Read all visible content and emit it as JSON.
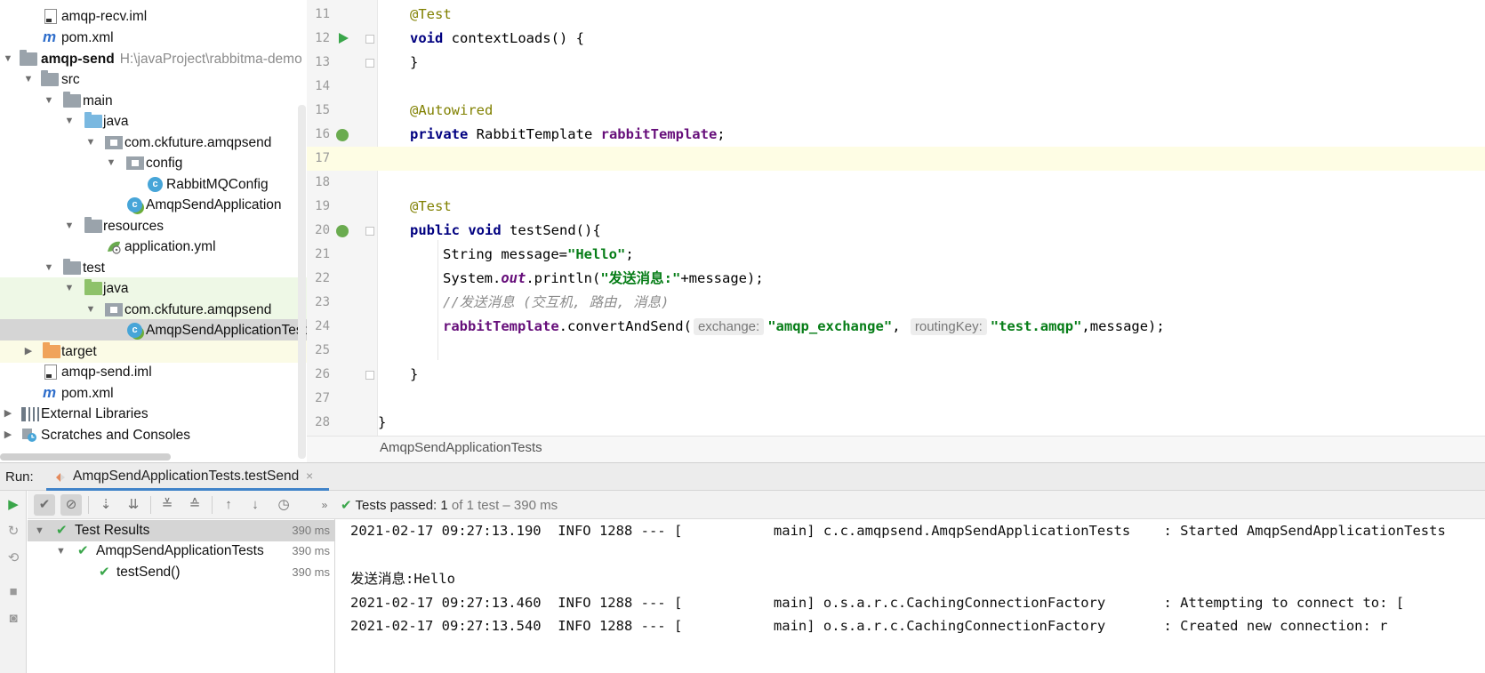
{
  "project_tree": {
    "items": [
      {
        "label": "amqp-recv.iml",
        "path": "",
        "icon": "iml-file-icon"
      },
      {
        "label": "pom.xml",
        "path": "",
        "icon": "maven-icon"
      },
      {
        "label": "amqp-send",
        "path": "H:\\javaProject\\rabbitma-demo",
        "icon": "module-folder-icon"
      },
      {
        "label": "src",
        "icon": "folder-icon"
      },
      {
        "label": "main",
        "icon": "folder-icon"
      },
      {
        "label": "java",
        "icon": "source-folder-icon"
      },
      {
        "label": "com.ckfuture.amqpsend",
        "icon": "package-icon"
      },
      {
        "label": "config",
        "icon": "package-icon"
      },
      {
        "label": "RabbitMQConfig",
        "icon": "class-icon"
      },
      {
        "label": "AmqpSendApplication",
        "icon": "spring-boot-class-icon"
      },
      {
        "label": "resources",
        "icon": "resources-folder-icon"
      },
      {
        "label": "application.yml",
        "icon": "yaml-icon"
      },
      {
        "label": "test",
        "icon": "folder-icon"
      },
      {
        "label": "java",
        "icon": "test-folder-icon"
      },
      {
        "label": "com.ckfuture.amqpsend",
        "icon": "package-icon"
      },
      {
        "label": "AmqpSendApplicationTests",
        "icon": "spring-boot-class-icon"
      },
      {
        "label": "target",
        "icon": "excluded-folder-icon"
      },
      {
        "label": "amqp-send.iml",
        "icon": "iml-file-icon"
      },
      {
        "label": "pom.xml",
        "icon": "maven-icon"
      },
      {
        "label": "External Libraries",
        "icon": "libraries-icon"
      },
      {
        "label": "Scratches and Consoles",
        "icon": "scratches-icon"
      }
    ],
    "class_glyph": "c"
  },
  "editor": {
    "line_numbers": [
      "11",
      "12",
      "13",
      "14",
      "15",
      "16",
      "17",
      "18",
      "19",
      "20",
      "21",
      "22",
      "23",
      "24",
      "25",
      "26",
      "27",
      "28"
    ],
    "tokens": {
      "l11_annotation": "@Test",
      "l12_kw": "void",
      "l12_rest": " contextLoads() {",
      "l13": "}",
      "l15_annotation": "@Autowired",
      "l16_kw": "private",
      "l16_type": " RabbitTemplate ",
      "l16_field": "rabbitTemplate",
      "l16_end": ";",
      "l19_annotation": "@Test",
      "l20_kw1": "public",
      "l20_sp": " ",
      "l20_kw2": "void",
      "l20_rest": " testSend(){",
      "l21_pre": "String message=",
      "l21_str": "\"Hello\"",
      "l21_end": ";",
      "l22_pre": "System.",
      "l22_static": "out",
      "l22_mid": ".println(",
      "l22_str": "\"发送消息:\"",
      "l22_end": "+message);",
      "l23_comment": "//发送消息 (交互机, 路由, 消息)",
      "l24_field": "rabbitTemplate",
      "l24_call": ".convertAndSend(",
      "l24_hint1": "exchange:",
      "l24_str1": "\"amqp_exchange\"",
      "l24_comma": ", ",
      "l24_hint2": "routingKey:",
      "l24_str2": "\"test.amqp\"",
      "l24_end": ",message);",
      "l26": "}",
      "l28": "}"
    },
    "breadcrumb": "AmqpSendApplicationTests"
  },
  "run_panel": {
    "label": "Run:",
    "tab_label": "AmqpSendApplicationTests.testSend",
    "close_glyph": "×",
    "status_prefix": "Tests passed:",
    "status_count": " 1",
    "status_suffix": " of 1 test – 390 ms",
    "results": [
      {
        "label": "Test Results",
        "time": "390 ms"
      },
      {
        "label": "AmqpSendApplicationTests",
        "time": "390 ms"
      },
      {
        "label": "testSend()",
        "time": "390 ms"
      }
    ],
    "console_lines": [
      "2021-02-17 09:27:13.190  INFO 1288 --- [           main] c.c.amqpsend.AmqpSendApplicationTests    : Started AmqpSendApplicationTests",
      "",
      "发送消息:Hello",
      "2021-02-17 09:27:13.460  INFO 1288 --- [           main] o.s.a.r.c.CachingConnectionFactory       : Attempting to connect to: [",
      "2021-02-17 09:27:13.540  INFO 1288 --- [           main] o.s.a.r.c.CachingConnectionFactory       : Created new connection: r"
    ]
  },
  "colors": {
    "keyword": "#000080",
    "annotation": "#808000",
    "string": "#067d17",
    "field": "#660e7a",
    "comment": "#8c8c8c",
    "pass": "#3aa64a",
    "tab_underline": "#4083c9"
  }
}
